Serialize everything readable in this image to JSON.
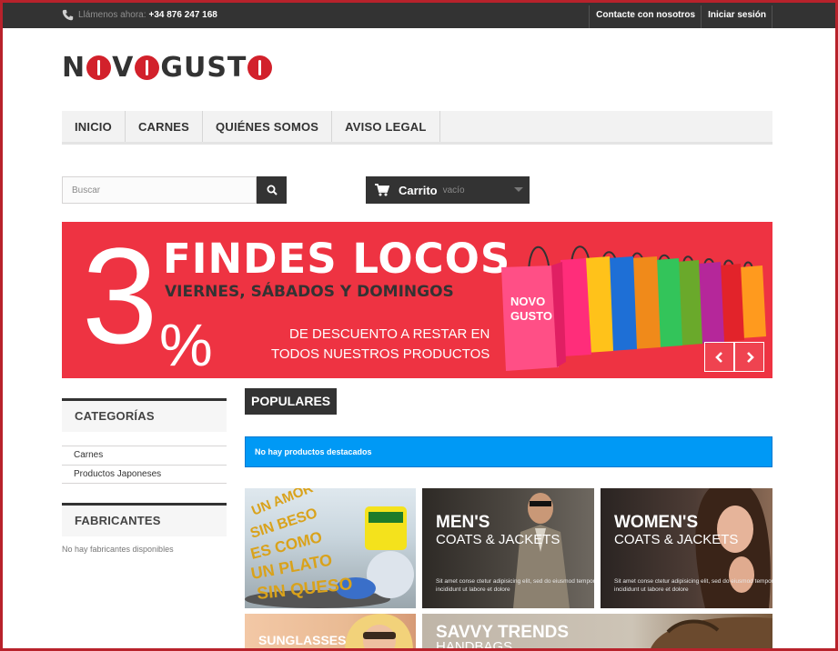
{
  "topbar": {
    "phone_label": "Llámenos ahora:",
    "phone_number": "+34 876 247 168",
    "links": [
      "Contacte con nosotros",
      "Iniciar sesión"
    ]
  },
  "logo": {
    "text_left": "N",
    "text_mid": "V",
    "text_right": "GUST"
  },
  "menu": {
    "items": [
      "INICIO",
      "CARNES",
      "QUIÉNES SOMOS",
      "AVISO LEGAL"
    ]
  },
  "search": {
    "placeholder": "Buscar"
  },
  "cart": {
    "label": "Carrito",
    "status": "vacío"
  },
  "banner": {
    "number": "3",
    "percent": "%",
    "title": "FINDES LOCOS",
    "days": "VIERNES, SÁBADOS Y DOMINGOS",
    "discount_line1": "DE DESCUENTO A RESTAR EN",
    "discount_line2": "TODOS NUESTROS PRODUCTOS",
    "bag_logo_line1": "NOVO",
    "bag_logo_line2": "GUSTO"
  },
  "sidebar": {
    "categories_title": "CATEGORÍAS",
    "categories": [
      "Carnes",
      "Productos Japoneses"
    ],
    "manufacturers_title": "FABRICANTES",
    "manufacturers_empty": "No hay fabricantes disponibles"
  },
  "main": {
    "popular_title": "POPULARES",
    "alert": "No hay productos destacados"
  },
  "tiles": {
    "t1_text": "UN AMOR SIN BESO ES COMO UN PLATO SIN QUESO",
    "t2_big": "MEN'S",
    "t2_sub": "COATS & JACKETS",
    "t2_desc": "Sit amet conse ctetur adipisicing elit, sed do eiusmod tempor incididunt ut labore et dolore",
    "t3_big": "WOMEN'S",
    "t3_sub": "COATS & JACKETS",
    "t3_desc": "Sit amet conse ctetur adipisicing elit, sed do eiusmod tempor incididunt ut labore et dolore",
    "t4_big": "SUNGLASSES",
    "t5_big": "SAVVY TRENDS",
    "t5_sub": "HANDBAGS"
  },
  "colors": {
    "brand_red": "#d2212b",
    "banner_red": "#ee3342",
    "dark": "#333333",
    "alert_blue": "#0099f5",
    "frame": "#b8222b"
  },
  "icons": [
    "phone-icon",
    "search-icon",
    "cart-icon",
    "chevron-left-icon",
    "chevron-right-icon"
  ]
}
